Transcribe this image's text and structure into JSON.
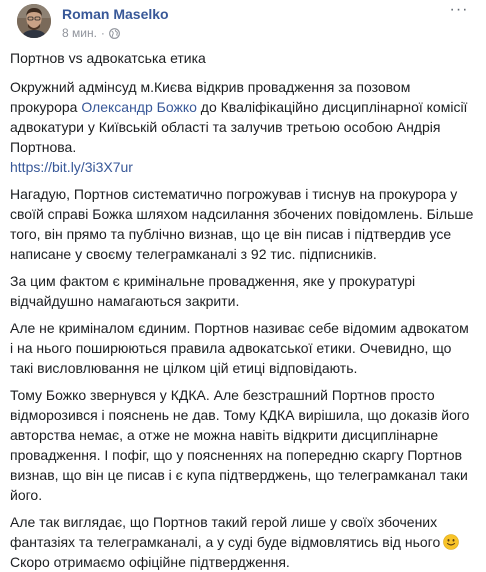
{
  "post": {
    "author": "Roman Maselko",
    "time": "8 мин.",
    "separator": "·",
    "more_label": "···",
    "privacy_icon": "globe-icon",
    "title": "Портнов vs адвокатська етика",
    "p1": {
      "before": "Окружний адмінсуд м.Києва відкрив провадження за позовом прокурора ",
      "link": "Олександр Божко",
      "after": " до Кваліфікаційно дисциплінарної комісії адвокатури у Київській області та залучив третьою особою Андрія Портнова.",
      "url": "https://bit.ly/3i3X7ur"
    },
    "p2": "Нагадую, Портнов систематично погрожував і тиснув на прокурора у своїй справі Божка шляхом надсилання збочених повідомлень. Більше того, він прямо та публічно визнав, що це він писав і підтвердив усе написане у своєму телеграмканалі з 92 тис. підписників.",
    "p3": "За цим фактом є кримінальне провадження, яке у прокуратурі відчайдушно намагаються закрити.",
    "p4": "Але не криміналом єдиним. Портнов називає себе відомим адвокатом і на нього поширюються правила адвокатської етики. Очевидно, що такі висловлювання не цілком цій етиці відповідають.",
    "p5": "Тому Божко звернувся у КДКА. Але безстрашний Портнов просто відморозився і пояснень не дав. Тому КДКА вирішила, що доказів його авторства немає, а отже не можна навіть відкрити дисциплінарне провадження. І пофіг, що у поясненнях на попередню скаргу Портнов визнав, що він це писав і є купа підтверджень, що телеграмканал таки його.",
    "p6": {
      "text": "Але так виглядає, що Портнов такий герой лише у своїх збочених фантазіях та телеграмканалі, а у суді буде відмовлятись від нього",
      "emoji": "slightly-smiling-face-emoji"
    },
    "p7": "Скоро отримаємо офіційне підтвердження."
  },
  "colors": {
    "link": "#385898",
    "text": "#1c1e21",
    "meta": "#90949c"
  }
}
